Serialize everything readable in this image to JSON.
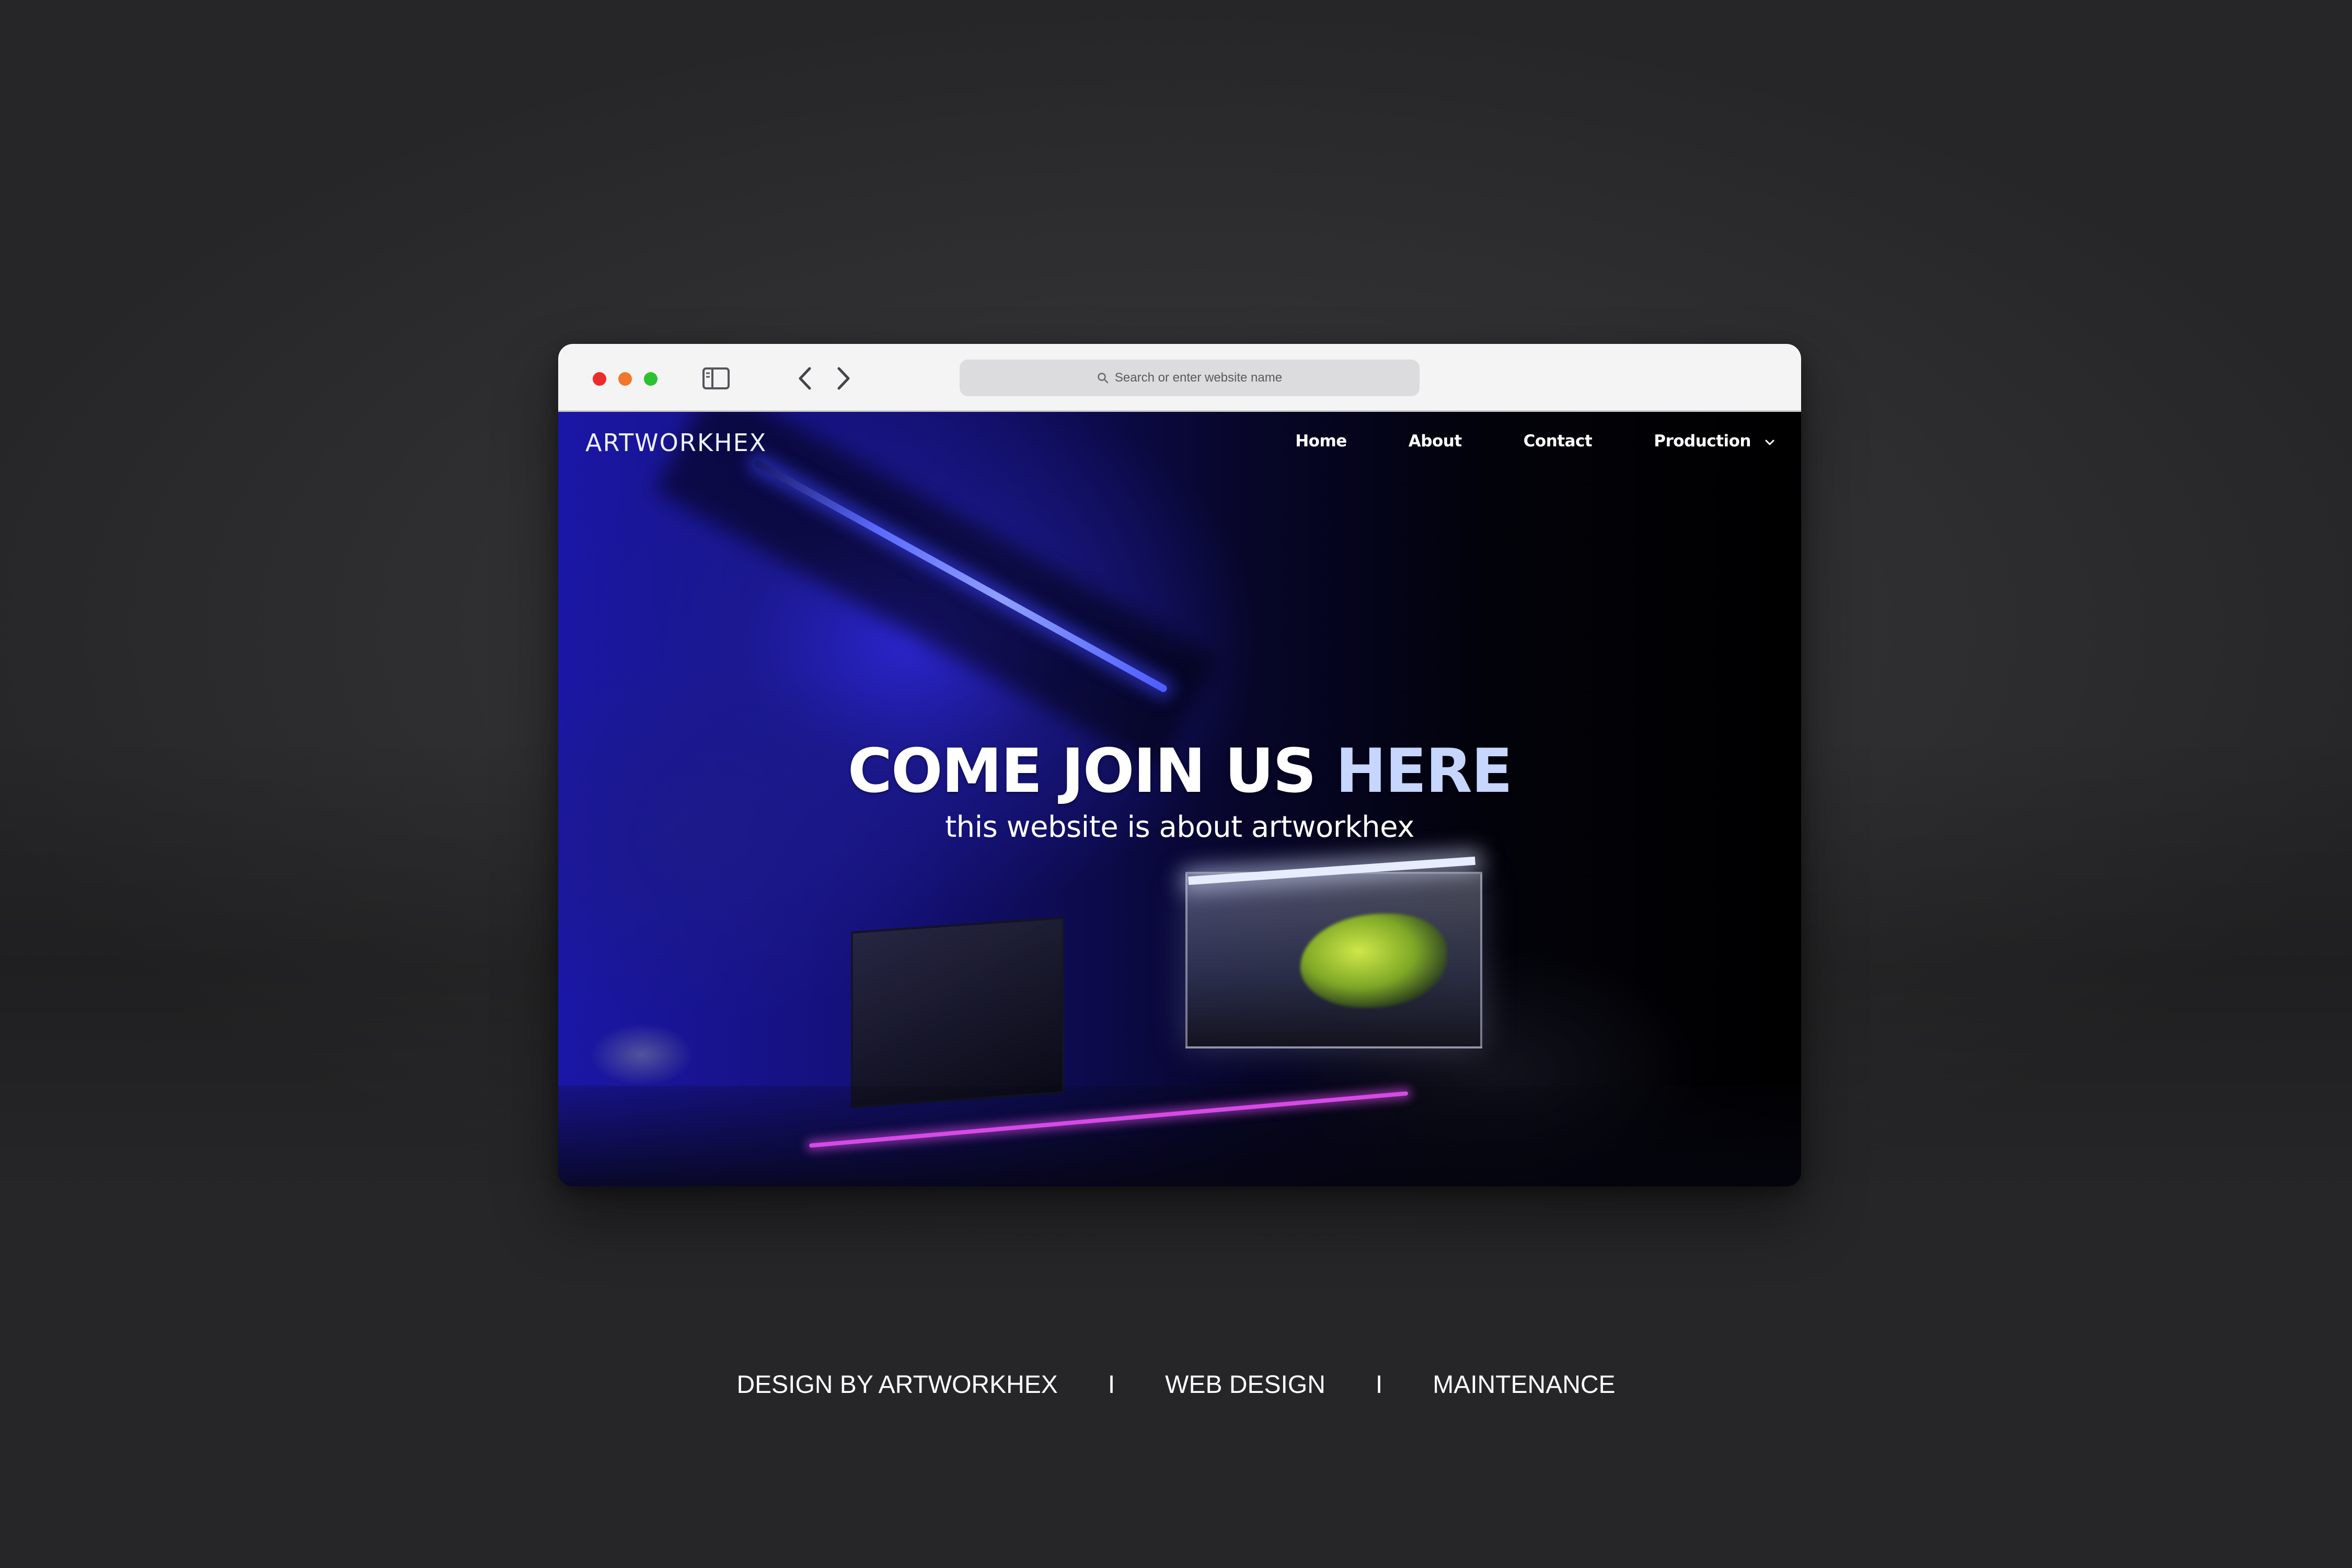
{
  "browser": {
    "address_placeholder": "Search or enter website name",
    "icons": [
      "sidebar-icon",
      "back-icon",
      "forward-icon",
      "plus-icon",
      "tabs-icon",
      "search-icon"
    ]
  },
  "site": {
    "logo": "ARTWORKHEX",
    "nav": {
      "items": [
        {
          "label": "Home"
        },
        {
          "label": "About"
        },
        {
          "label": "Contact"
        },
        {
          "label": "Production",
          "has_dropdown": true
        }
      ]
    },
    "hero": {
      "headline_main": "COME JOIN US ",
      "headline_accent": "HERE",
      "subline": "this website is about artworkhex"
    }
  },
  "caption": {
    "item1": "DESIGN BY ARTWORKHEX",
    "sep1": "I",
    "item2": "WEB DESIGN",
    "sep2": "I",
    "item3": "MAINTENANCE"
  },
  "colors": {
    "traffic_red": "#ee2b2b",
    "traffic_yellow": "#f2772a",
    "traffic_green": "#2bc12f",
    "headline_accent": "#c6d6ff",
    "background": "#313133"
  }
}
